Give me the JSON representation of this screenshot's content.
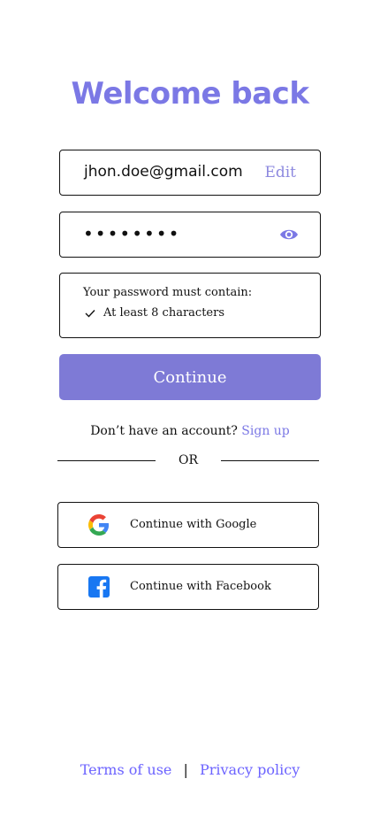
{
  "title": "Welcome back",
  "email": {
    "value": "jhon.doe@gmail.com",
    "edit_label": "Edit"
  },
  "password": {
    "masked_value": "••••••••",
    "icon": "eye-icon"
  },
  "requirements": {
    "title": "Your password must contain:",
    "items": [
      {
        "label": "At least 8 characters",
        "met": true
      }
    ]
  },
  "continue_label": "Continue",
  "signup": {
    "prompt": "Don’t have an account?",
    "link_label": "Sign up"
  },
  "divider_label": "OR",
  "social": {
    "google_label": "Continue with Google",
    "facebook_label": "Continue with Facebook"
  },
  "footer": {
    "terms_label": "Terms of use",
    "separator": "|",
    "privacy_label": "Privacy policy"
  },
  "colors": {
    "accent": "#7b78e5",
    "button": "#7e7ad6",
    "link": "#6c63ff",
    "facebook": "#1877f2"
  }
}
